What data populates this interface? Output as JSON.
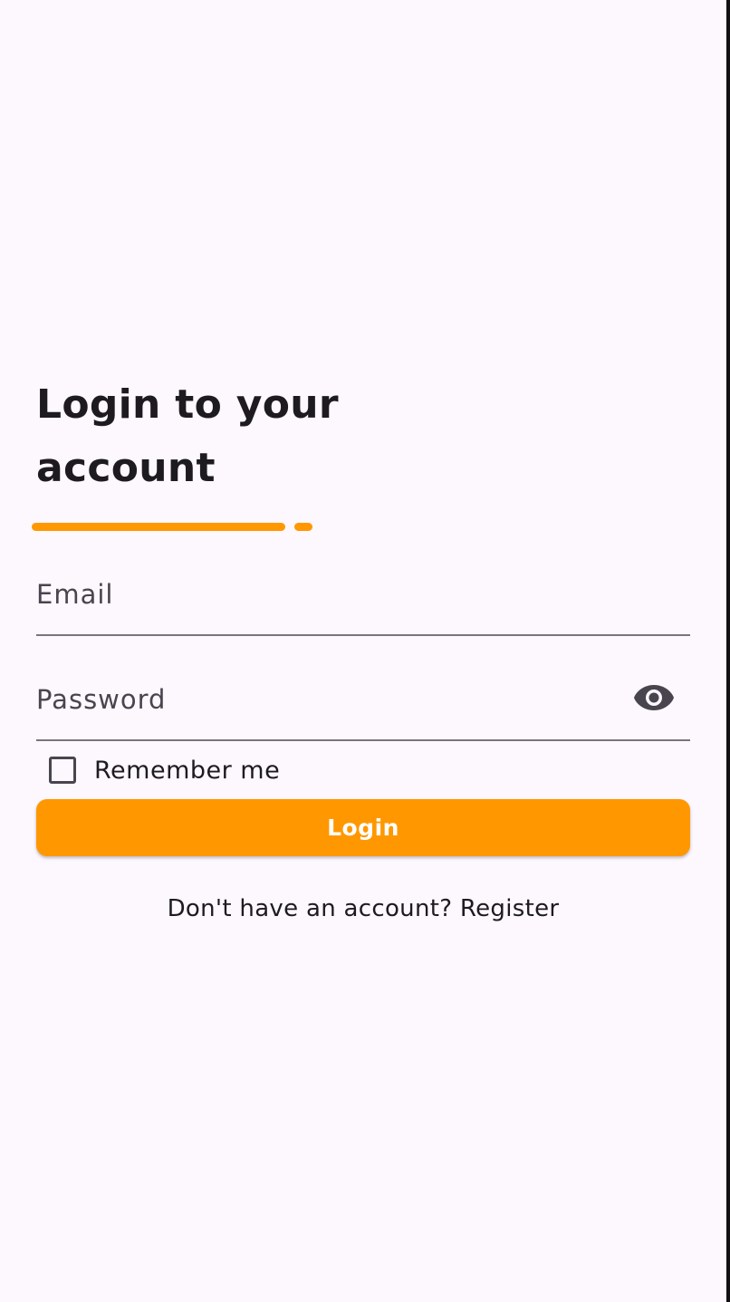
{
  "login": {
    "title": "Login to your account",
    "email": {
      "placeholder": "Email",
      "value": ""
    },
    "password": {
      "placeholder": "Password",
      "value": "",
      "toggle_icon": "eye-icon"
    },
    "remember_me": {
      "label": "Remember me",
      "checked": false
    },
    "submit_label": "Login",
    "register_prompt": "Don't have an account?",
    "register_link": "Register"
  },
  "colors": {
    "background": "#fdf7fe",
    "accent": "#ff9800",
    "text": "#1d1b20",
    "outline": "#79747e"
  }
}
